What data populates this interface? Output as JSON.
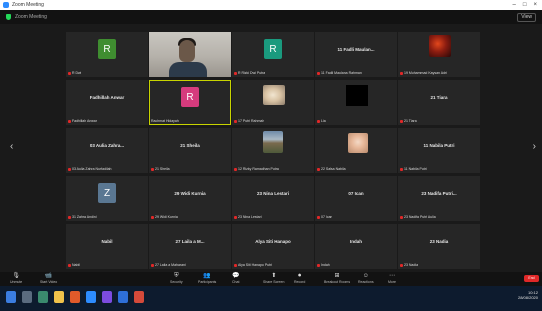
{
  "window": {
    "title": "Zoom Meeting"
  },
  "topbar": {
    "meeting_label": "Zoom Meeting",
    "view_label": "View"
  },
  "nav": {
    "prev_glyph": "‹",
    "next_glyph": "›"
  },
  "tiles": [
    {
      "type": "avatar",
      "letter": "R",
      "color": "#3f8d30",
      "name": "R Dwi",
      "muted": true
    },
    {
      "type": "camera",
      "name": "",
      "muted": false
    },
    {
      "type": "avatar",
      "letter": "R",
      "color": "#1a9a7e",
      "name": "R Rizki Dwi Putra",
      "muted": true
    },
    {
      "type": "name",
      "big": "11 Fadli Maulan...",
      "name": "11 Fadli Maulana Rahman",
      "muted": true
    },
    {
      "type": "photo",
      "photo": "red",
      "name": "19 Muhammad Kaysan Adri",
      "muted": true
    },
    {
      "type": "name",
      "big": "Fadhillah Anwar",
      "name": "Fadhillah Anwar",
      "muted": true
    },
    {
      "type": "avatar",
      "letter": "R",
      "color": "#d63b7d",
      "name": "Rachmat Hidayah",
      "muted": false,
      "speaking": true
    },
    {
      "type": "photo",
      "photo": "egg",
      "name": "17 Putri Rahmah",
      "muted": true
    },
    {
      "type": "photo",
      "photo": "black",
      "name": "Lia",
      "muted": true
    },
    {
      "type": "name",
      "big": "21 Tiara",
      "name": "21 Tiara",
      "muted": true
    },
    {
      "type": "name",
      "big": "03 Aulia Zahra...",
      "name": "03 Aulia Zahra Nurfadilah",
      "muted": true
    },
    {
      "type": "name",
      "big": "21 Sheila",
      "name": "21 Sheila",
      "muted": true
    },
    {
      "type": "photo",
      "photo": "landscape",
      "name": "12 Rizky Ramadhan Putra",
      "muted": true
    },
    {
      "type": "photo",
      "photo": "cat",
      "name": "22 Salsa Nabila",
      "muted": true
    },
    {
      "type": "name",
      "big": "11 Nabila Putri",
      "name": "11 Nabila Putri",
      "muted": true
    },
    {
      "type": "avatar",
      "letter": "Z",
      "color": "#5a7792",
      "name": "31 Zahra Andini",
      "muted": true
    },
    {
      "type": "name",
      "big": "29 Widi Kurnia",
      "name": "29 Widi Kurnia",
      "muted": true
    },
    {
      "type": "name",
      "big": "23 Nina Lestari",
      "name": "23 Nina Lestari",
      "muted": true
    },
    {
      "type": "name",
      "big": "07 Ican",
      "name": "07 Ican",
      "muted": true
    },
    {
      "type": "name",
      "big": "23 Nadifa Putri...",
      "name": "23 Nadifa Putri Aulia",
      "muted": true
    },
    {
      "type": "name",
      "big": "Nabil",
      "name": "Nabil",
      "muted": true
    },
    {
      "type": "name",
      "big": "27 Laila a M...",
      "name": "27 Laila a Maharani",
      "muted": true
    },
    {
      "type": "name",
      "big": "Alya Siti Hanapo",
      "name": "Alya Siti Hanapo Putri",
      "muted": true
    },
    {
      "type": "name",
      "big": "Indah",
      "name": "Indah",
      "muted": true
    },
    {
      "type": "name",
      "big": "23 Nadia",
      "name": "23 Nadia",
      "muted": true
    }
  ],
  "toolbar": {
    "items": [
      {
        "label": "Unmute",
        "glyph": "🎙"
      },
      {
        "label": "Start Video",
        "glyph": "📹"
      },
      {
        "label": "Security",
        "glyph": "⛨"
      },
      {
        "label": "Participants",
        "glyph": "👥"
      },
      {
        "label": "Chat",
        "glyph": "💬"
      },
      {
        "label": "Share Screen",
        "glyph": "⬆"
      },
      {
        "label": "Record",
        "glyph": "⏺"
      },
      {
        "label": "Breakout Rooms",
        "glyph": "⊞"
      },
      {
        "label": "Reactions",
        "glyph": "☺"
      },
      {
        "label": "More",
        "glyph": "⋯"
      }
    ],
    "end_label": "End"
  },
  "taskbar": {
    "time": "10:12",
    "date": "28/08/2020"
  }
}
